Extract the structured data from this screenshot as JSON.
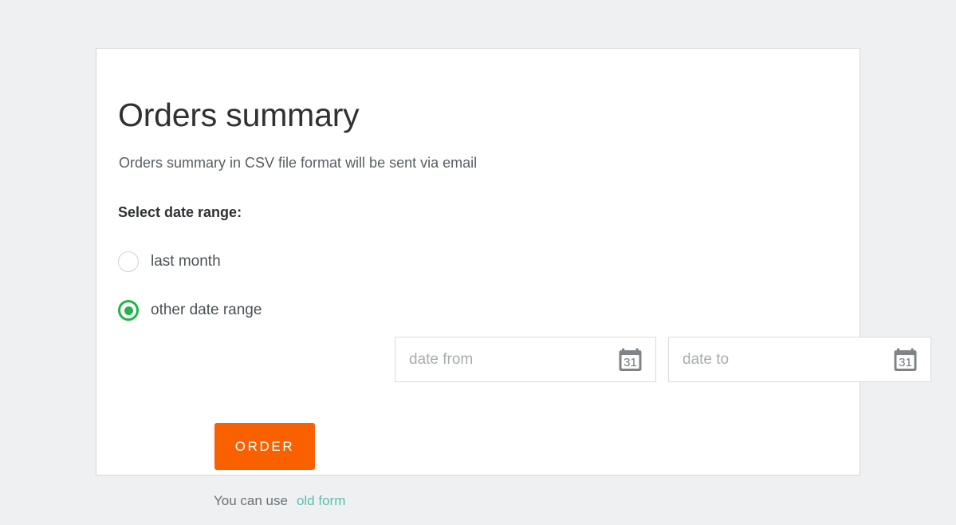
{
  "card": {
    "title": "Orders summary",
    "subtitle": "Orders summary in CSV file format will be sent via email",
    "form": {
      "legend": "Select date range:",
      "options": [
        {
          "label": "last month",
          "selected": false
        },
        {
          "label": "other date range",
          "selected": true
        }
      ],
      "date_from": {
        "placeholder": "date from",
        "value": "",
        "icon": "calendar-icon",
        "icon_day": "31"
      },
      "date_to": {
        "placeholder": "date to",
        "value": "",
        "icon": "calendar-icon",
        "icon_day": "31"
      },
      "submit_label": "ORDER"
    },
    "footer": {
      "text": "You can use",
      "link_label": "old form"
    }
  },
  "colors": {
    "page_background": "#eef0f1",
    "card_background": "#ffffff",
    "card_border": "#d4d6d8",
    "accent_orange": "#f96100",
    "accent_green": "#23b24b",
    "link_teal": "#5bbfae",
    "heading_text": "#2f3133",
    "body_text": "#575e63",
    "placeholder_text": "#a8adb1"
  }
}
